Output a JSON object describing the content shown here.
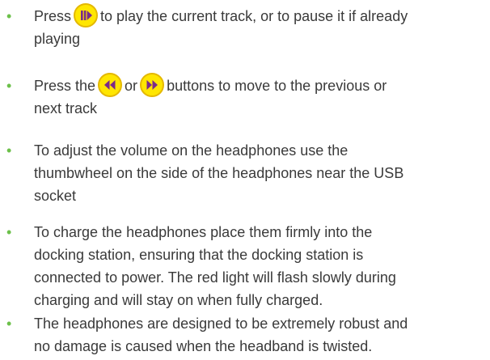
{
  "bullet_char": "•",
  "items": [
    {
      "pre": "Press",
      "post": "to play the current track, or to pause it if already",
      "line2": "playing"
    },
    {
      "pre": "Press the",
      "mid": "or",
      "post": "buttons to move to the previous or",
      "line2": "next track"
    },
    {
      "lines": [
        "To adjust the volume on the headphones use the",
        "thumbwheel on the side of the headphones near the USB",
        "socket"
      ]
    },
    {
      "lines": [
        "To charge the headphones place them firmly into the",
        "docking station, ensuring that the docking station is",
        "connected to power. The red light will flash slowly during",
        "charging and will stay on when fully charged."
      ]
    },
    {
      "lines": [
        "The headphones are designed to be extremely robust and",
        "no damage is caused when the headband is twisted."
      ]
    }
  ],
  "icons": {
    "play_pause": "play-pause-icon",
    "previous": "previous-track-icon",
    "next": "next-track-icon"
  },
  "colors": {
    "bullet": "#6cc04a",
    "button_fill": "#ffe600",
    "button_border": "#e4b800",
    "icon": "#7a2a8a",
    "text": "#3a3a3a"
  }
}
